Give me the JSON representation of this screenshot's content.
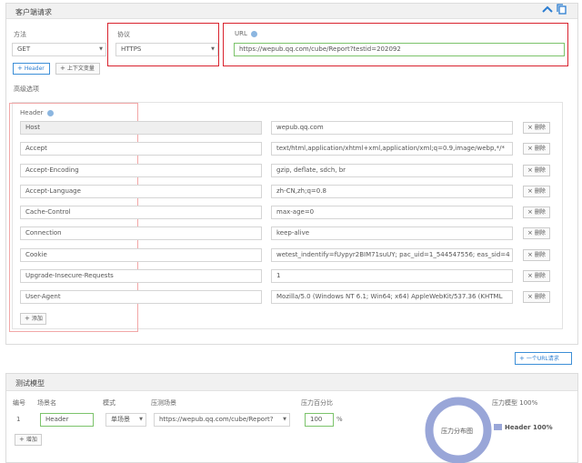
{
  "client": {
    "title": "客户端请求",
    "method_label": "方法",
    "method_value": "GET",
    "protocol_label": "协议",
    "protocol_value": "HTTPS",
    "url_label": "URL",
    "url_value": "https://wepub.qq.com/cube/Report?testid=202092",
    "add_header_btn": "Header",
    "add_context_btn": "上下文变量",
    "advanced_label": "高级选项",
    "header_label": "Header",
    "delete_label": "删除",
    "add_row_btn": "添加",
    "headers": [
      {
        "name": "Host",
        "value": "wepub.qq.com"
      },
      {
        "name": "Accept",
        "value": "text/html,application/xhtml+xml,application/xml;q=0.9,image/webp,*/*"
      },
      {
        "name": "Accept-Encoding",
        "value": "gzip, deflate, sdch, br"
      },
      {
        "name": "Accept-Language",
        "value": "zh-CN,zh;q=0.8"
      },
      {
        "name": "Cache-Control",
        "value": "max-age=0"
      },
      {
        "name": "Connection",
        "value": "keep-alive"
      },
      {
        "name": "Cookie",
        "value": "wetest_indentify=fUypyr2BIM71suUY; pac_uid=1_544547556; eas_sid=4"
      },
      {
        "name": "Upgrade-Insecure-Requests",
        "value": "1"
      },
      {
        "name": "User-Agent",
        "value": "Mozilla/5.0 (Windows NT 6.1; Win64; x64) AppleWebKit/537.36 (KHTML"
      }
    ]
  },
  "add_url_request_btn": "一个URL请求",
  "model": {
    "title": "测试模型",
    "col_no": "编号",
    "col_scene": "场景名",
    "col_mode": "模式",
    "col_target": "压测场景",
    "col_percent": "压力百分比",
    "row_no": "1",
    "scene_value": "Header",
    "mode_value": "单场景",
    "target_value": "https://wepub.qq.com/cube/Report?",
    "percent_value": "100",
    "percent_unit": "%",
    "add_btn": "增加",
    "donut_label": "压力分布图",
    "pressure_model_label": "压力模型",
    "pressure_model_value": "100%",
    "legend_entry": "Header 100%"
  },
  "colors": {
    "accent_blue": "#2b7dd1",
    "highlight_red": "#d9232e",
    "donut": "#99a6d8",
    "green_border": "#7cc36b"
  },
  "icons": [
    "chevron-up-icon",
    "copy-icon",
    "help-icon",
    "close-icon",
    "plus-icon",
    "caret-down-icon"
  ]
}
